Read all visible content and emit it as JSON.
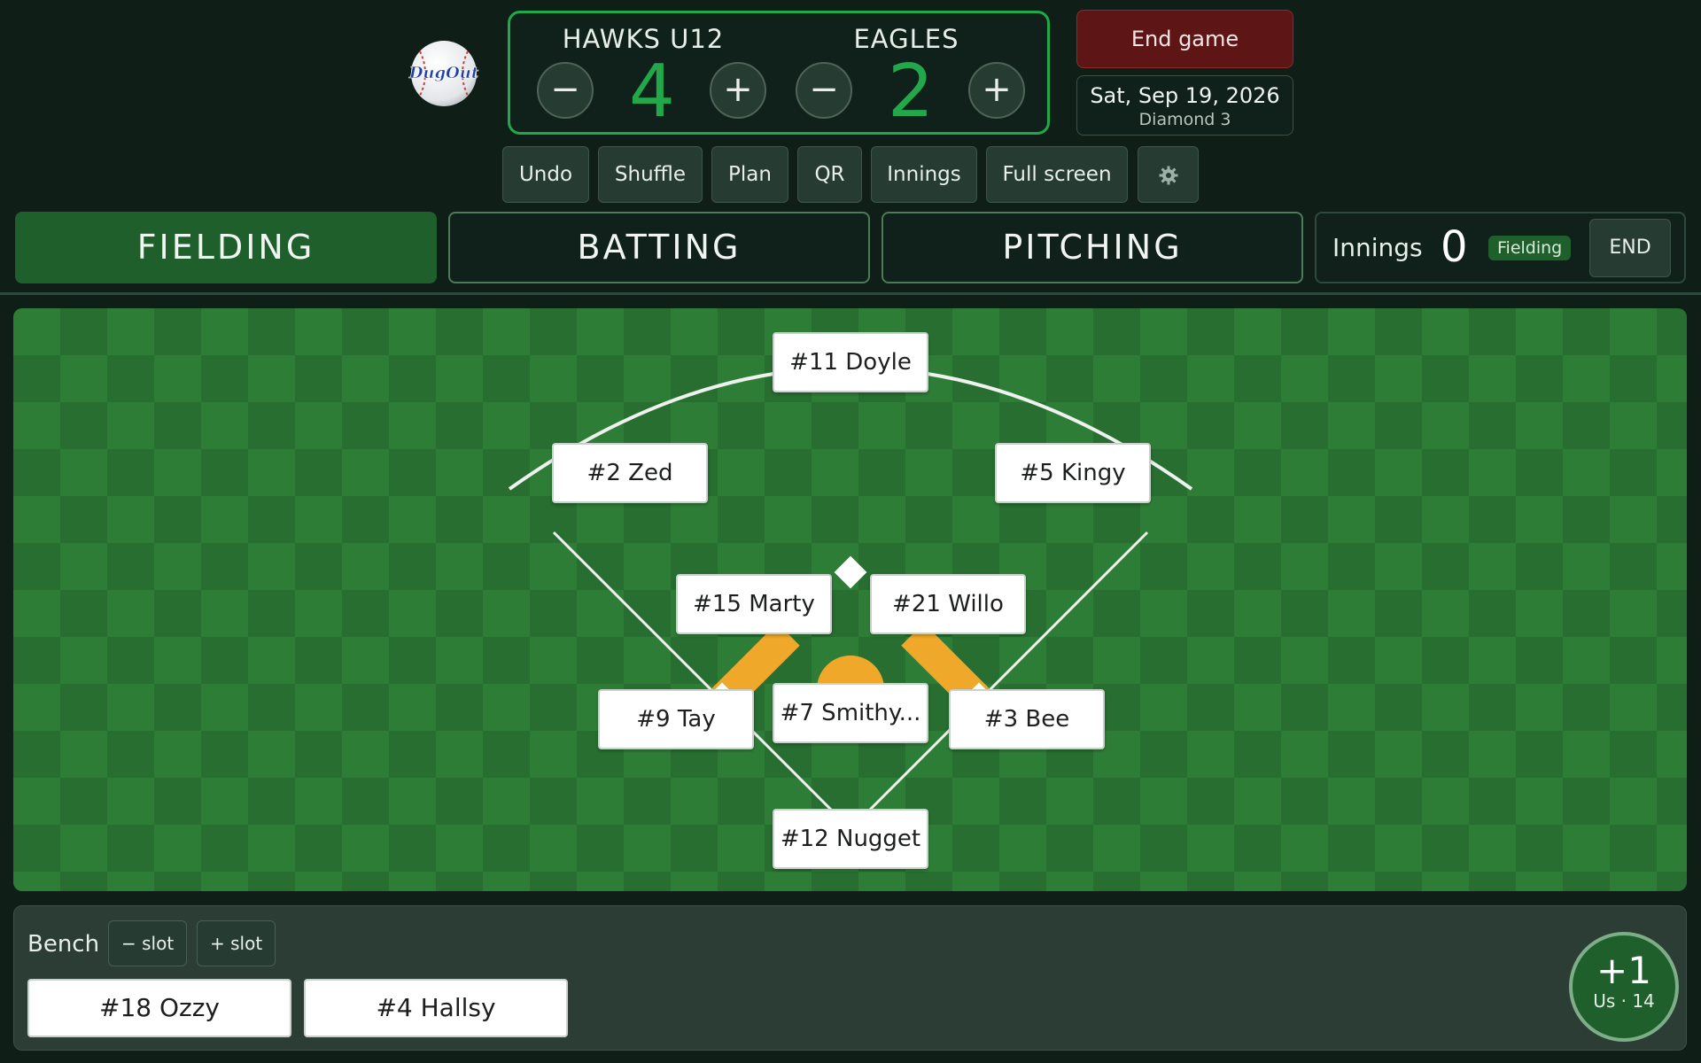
{
  "app": {
    "logo_text": "DugOut"
  },
  "scoreboard": {
    "home": {
      "name": "HAWKS U12",
      "score": "4",
      "minus": "−",
      "plus": "+"
    },
    "away": {
      "name": "EAGLES",
      "score": "2",
      "minus": "−",
      "plus": "+"
    }
  },
  "game": {
    "end_label": "End game",
    "date": "Sat, Sep 19, 2026",
    "venue": "Diamond 3"
  },
  "toolbar": {
    "undo": "Undo",
    "shuffle": "Shuffle",
    "plan": "Plan",
    "qr": "QR",
    "innings": "Innings",
    "fullscreen": "Full screen",
    "settings_icon": "gear-icon"
  },
  "tabs": [
    {
      "label": "FIELDING",
      "active": true
    },
    {
      "label": "BATTING",
      "active": false
    },
    {
      "label": "PITCHING",
      "active": false
    }
  ],
  "innings": {
    "label": "Innings",
    "count": "0",
    "mode": "Fielding",
    "end_label": "END"
  },
  "field": {
    "positions": {
      "cf": "#11 Doyle",
      "lf": "#2 Zed",
      "rf": "#5 Kingy",
      "ss": "#15 Marty",
      "b2": "#21 Willo",
      "b3": "#9 Tay",
      "p": "#7 Smithy...",
      "b1": "#3 Bee",
      "c": "#12 Nugget"
    }
  },
  "bench": {
    "label": "Bench",
    "minus_slot": "− slot",
    "plus_slot": "+ slot",
    "players": [
      "#18 Ozzy",
      "#4 Hallsy"
    ]
  },
  "run_button": {
    "main": "+1",
    "sub": "Us · 14"
  },
  "colors": {
    "accent_green": "#22a84b",
    "danger_red": "#5e1515",
    "infield_dirt": "#f0a82a",
    "field_light": "#2e7d37",
    "field_dark": "#276e30"
  }
}
